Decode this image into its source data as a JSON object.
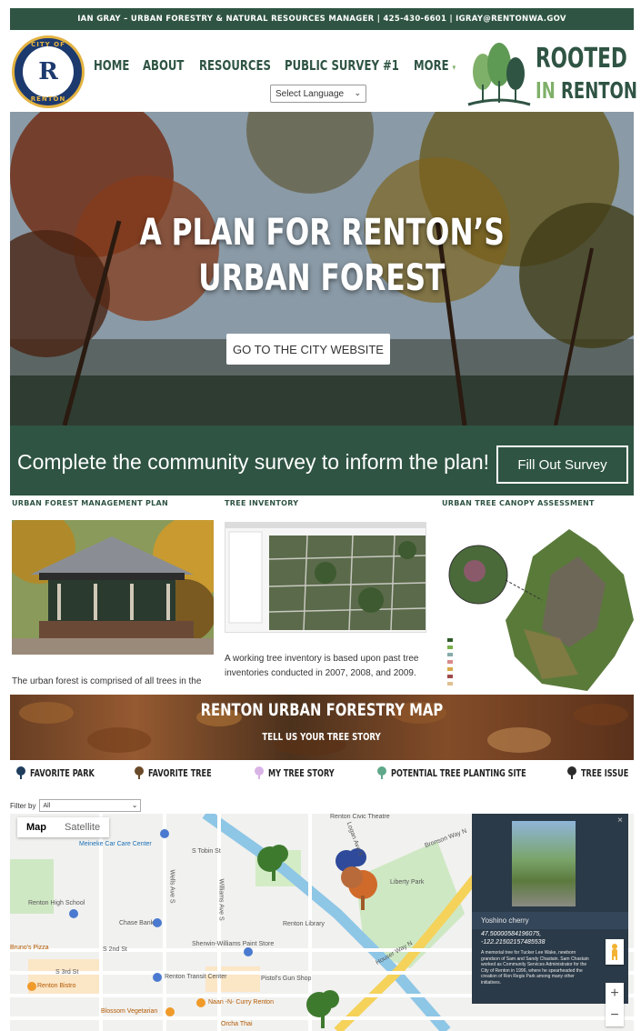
{
  "topbar": {
    "contact": "IAN GRAY – URBAN FORESTRY & NATURAL RESOURCES MANAGER | 425-430-6601 | IGRAY@RENTONWA.GOV"
  },
  "header": {
    "city_logo": {
      "top_text": "CITY OF",
      "bottom_text": "RENTON",
      "monogram": "R"
    },
    "nav": [
      {
        "label": "HOME"
      },
      {
        "label": "ABOUT"
      },
      {
        "label": "RESOURCES"
      },
      {
        "label": "PUBLIC SURVEY #1"
      },
      {
        "label": "MORE"
      }
    ],
    "language_select": "Select Language",
    "brand_logo": {
      "line1": "ROOTED",
      "line2_in": "IN",
      "line2_rest": " RENTON"
    }
  },
  "hero": {
    "title_line1": "A PLAN FOR RENTON’S",
    "title_line2": "URBAN FOREST",
    "button": "GO TO THE CITY WEBSITE"
  },
  "survey": {
    "text": "Complete the community survey to inform the plan!",
    "button": "Fill Out Survey"
  },
  "columns": [
    {
      "heading": "URBAN FOREST MANAGEMENT PLAN",
      "text": "The urban forest is comprised of all trees in the"
    },
    {
      "heading": "TREE INVENTORY",
      "text": "A working tree inventory is based upon past tree inventories conducted in 2007, 2008, and 2009."
    },
    {
      "heading": "URBAN TREE CANOPY ASSESSMENT",
      "text": ""
    }
  ],
  "forestry_map": {
    "title": "RENTON URBAN FORESTRY MAP",
    "subtitle": "TELL US YOUR TREE STORY"
  },
  "legend": [
    {
      "label": "FAVORITE PARK",
      "icon": "tree-icon",
      "color": "#1f3d5c"
    },
    {
      "label": "FAVORITE TREE",
      "icon": "tree-icon",
      "color": "#6b4a2a"
    },
    {
      "label": "MY TREE STORY",
      "icon": "tree-icon",
      "color": "#d9b3e6"
    },
    {
      "label": "POTENTIAL TREE PLANTING SITE",
      "icon": "tree-icon",
      "color": "#5fa88a"
    },
    {
      "label": "TREE ISSUE",
      "icon": "tree-icon",
      "color": "#2b2b2b"
    }
  ],
  "filter": {
    "label": "Filter by",
    "value": "All"
  },
  "map": {
    "type_controls": {
      "map": "Map",
      "satellite": "Satellite"
    },
    "labels": {
      "meineke": "Meineke Car Care Center",
      "renton_high": "Renton High School",
      "chase": "Chase Bank",
      "renton_library": "Renton Library",
      "liberty_park": "Liberty Park",
      "sherwin": "Sherwin-Williams Paint Store",
      "transit": "Renton Transit Center",
      "gun_shop": "Pistol's Gun Shop",
      "pizza": "Bruno's Pizza",
      "renton_bistro": "Renton Bistro",
      "blossom": "Blossom Vegetarian",
      "naan": "Naan -N- Curry Renton",
      "orcha": "Orcha Thai",
      "s2nd": "S 2nd St",
      "s3rd": "S 3rd St",
      "wells": "Wells Ave S",
      "williams": "Williams Ave S",
      "bronson": "Bronson Way N",
      "houser": "Houser Way N",
      "logan": "Logan Ave S",
      "s_tobin": "S Tobin St",
      "theatre": "Renton Civic Theatre"
    },
    "popup": {
      "name": "Yoshino cherry",
      "coords_line1": "47.50000584196075,",
      "coords_line2": "-122.21502157485538",
      "description": "A memorial tree for Tucker Lee Wake, newborn grandson of Sam and Sandy Chastain. Sam Chastain worked as Community Services Administrator for the City of Renton in 1996, where he spearheaded the creation of Ron Regis Park among many other initiatives."
    },
    "zoom": {
      "in": "+",
      "out": "−"
    }
  }
}
